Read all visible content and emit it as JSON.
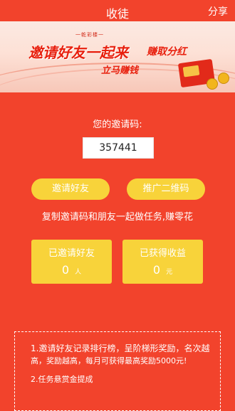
{
  "header": {
    "title": "收徒",
    "share_label": "分享"
  },
  "banner": {
    "tag": "一乾彩楼一",
    "headline": "邀请好友一起来",
    "side": "赚取分红",
    "sub": "立马赚钱"
  },
  "invite": {
    "label": "您的邀请码:",
    "code": "357441"
  },
  "buttons": {
    "invite_label": "邀请好友",
    "qr_label": "推广二维码"
  },
  "hint": "复制邀请码和朋友一起做任务,赚零花",
  "stats": {
    "invited": {
      "title": "已邀请好友",
      "value": "0",
      "unit": "人"
    },
    "earned": {
      "title": "已获得收益",
      "value": "0",
      "unit": "元"
    }
  },
  "rules": {
    "item1_line1": "1.邀请好友记录排行榜，呈阶梯形奖励，名次越",
    "item1_line2": "高，奖励越高，每月可获得最高奖励5000元!",
    "item2": "2.任务悬赏金提成"
  },
  "colors": {
    "background": "#f2432c",
    "accent_yellow": "#f8d33a"
  }
}
